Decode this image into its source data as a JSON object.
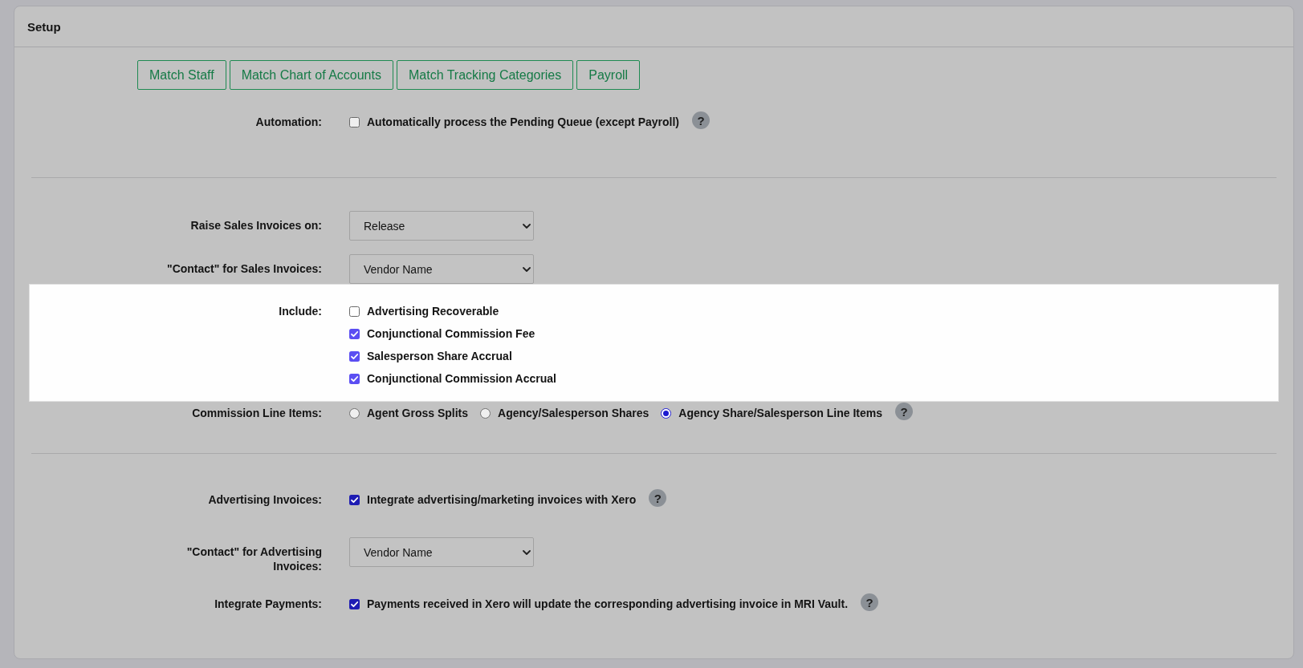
{
  "panel": {
    "title": "Setup"
  },
  "sections": [
    {
      "buttons": [
        "Match Staff",
        "Match Chart of Accounts",
        "Match Tracking Categories",
        "Payroll"
      ],
      "fields": [
        {
          "kind": "checks",
          "label": "Automation:",
          "highlighted": false,
          "options": [
            {
              "label": "Automatically process the Pending Queue (except Payroll)",
              "checked": false
            }
          ],
          "help": "?"
        }
      ]
    },
    {
      "fields": [
        {
          "kind": "select",
          "label": "Raise Sales Invoices on:",
          "highlighted": false,
          "value": "Release"
        },
        {
          "kind": "select",
          "label": "\"Contact\" for Sales Invoices:",
          "highlighted": false,
          "value": "Vendor Name"
        },
        {
          "kind": "checks",
          "label": "Include:",
          "highlighted": true,
          "options": [
            {
              "label": "Advertising Recoverable",
              "checked": false
            },
            {
              "label": "Conjunctional Commission Fee",
              "checked": true
            },
            {
              "label": "Salesperson Share Accrual",
              "checked": true
            },
            {
              "label": "Conjunctional Commission Accrual",
              "checked": true
            }
          ]
        },
        {
          "kind": "radios",
          "label": "Commission Line Items:",
          "highlighted": false,
          "options": [
            {
              "label": "Agent Gross Splits",
              "selected": false
            },
            {
              "label": "Agency/Salesperson Shares",
              "selected": false
            },
            {
              "label": "Agency Share/Salesperson Line Items",
              "selected": true
            }
          ],
          "help": "?"
        }
      ]
    },
    {
      "fields": [
        {
          "kind": "checks",
          "label": "Advertising Invoices:",
          "highlighted": false,
          "options": [
            {
              "label": "Integrate advertising/marketing invoices with Xero",
              "checked": true
            }
          ],
          "help": "?"
        },
        {
          "kind": "select",
          "label": "\"Contact\" for Advertising Invoices:",
          "highlighted": false,
          "value": "Vendor Name"
        },
        {
          "kind": "checks",
          "label": "Integrate Payments:",
          "highlighted": false,
          "options": [
            {
              "label": "Payments received in Xero will update the corresponding advertising invoice in MRI Vault.",
              "checked": true
            }
          ],
          "help": "?"
        }
      ]
    }
  ]
}
